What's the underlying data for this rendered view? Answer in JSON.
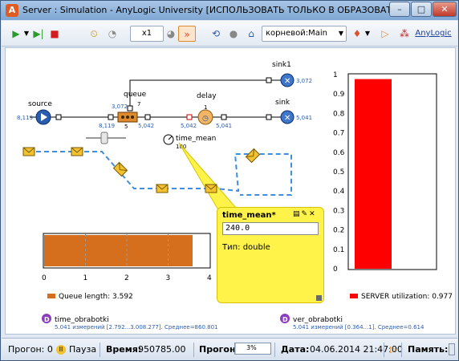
{
  "window": {
    "title": "Server : Simulation - AnyLogic University  [ИСПОЛЬЗОВАТЬ ТОЛЬКО В ОБРАЗОВАТЕЛЬН...",
    "app_icon": "anylogic-icon",
    "minimize": "–",
    "maximize": "□",
    "close": "✕"
  },
  "toolbar": {
    "speed_value": "x1",
    "experiment_select": "корневой:Main",
    "anylogic_link": "AnyLogic"
  },
  "model": {
    "source": {
      "label": "source",
      "count": "8,119"
    },
    "queue": {
      "label": "queue",
      "in": "8,119",
      "top": "3,072",
      "size": "5",
      "capacity": "7",
      "out": "5,042"
    },
    "delay": {
      "label": "delay",
      "in": "5,042",
      "size": "1",
      "out": "5,041"
    },
    "sink1": {
      "label": "sink1",
      "count": "3,072"
    },
    "sink": {
      "label": "sink",
      "count": "5,041"
    },
    "time_mean": {
      "label": "time_mean",
      "value": "180"
    }
  },
  "popup": {
    "title": "time_mean*",
    "input_value": "240.0",
    "type_label": "Тип: double"
  },
  "queue_chart": {
    "legend": "Queue length: 3.592",
    "color": "#d56f1e",
    "value": 3.592,
    "xlim": [
      0,
      4
    ],
    "ticks": [
      "0",
      "1",
      "2",
      "3",
      "4"
    ]
  },
  "util_chart": {
    "legend": "SERVER utilization: 0.977",
    "color": "#ff0000",
    "value": 0.977,
    "ylim": [
      0,
      1
    ],
    "ticks": [
      "0",
      "0.1",
      "0.2",
      "0.3",
      "0.4",
      "0.5",
      "0.6",
      "0.7",
      "0.8",
      "0.9",
      "1"
    ]
  },
  "datasets": {
    "time_obrabotki": {
      "name": "time_obrabotki",
      "summary": "5.041 измерений [2.792...3.008.277]. Среднее=860.801"
    },
    "ver_obrabotki": {
      "name": "ver_obrabotki",
      "summary": "5.041 измерений [0.364...1]. Среднее=0.614"
    }
  },
  "status": {
    "run_label": "Прогон: 0",
    "pause_label": "Пауза",
    "time_label": "Время:",
    "time_value": "950785.00",
    "progress_label": "Прогон:",
    "progress_value": "3%",
    "progress_fraction": 0.03,
    "date_label": "Дата:",
    "date_value": "04.06.2014 21:47:00",
    "memory_label": "Память:"
  }
}
